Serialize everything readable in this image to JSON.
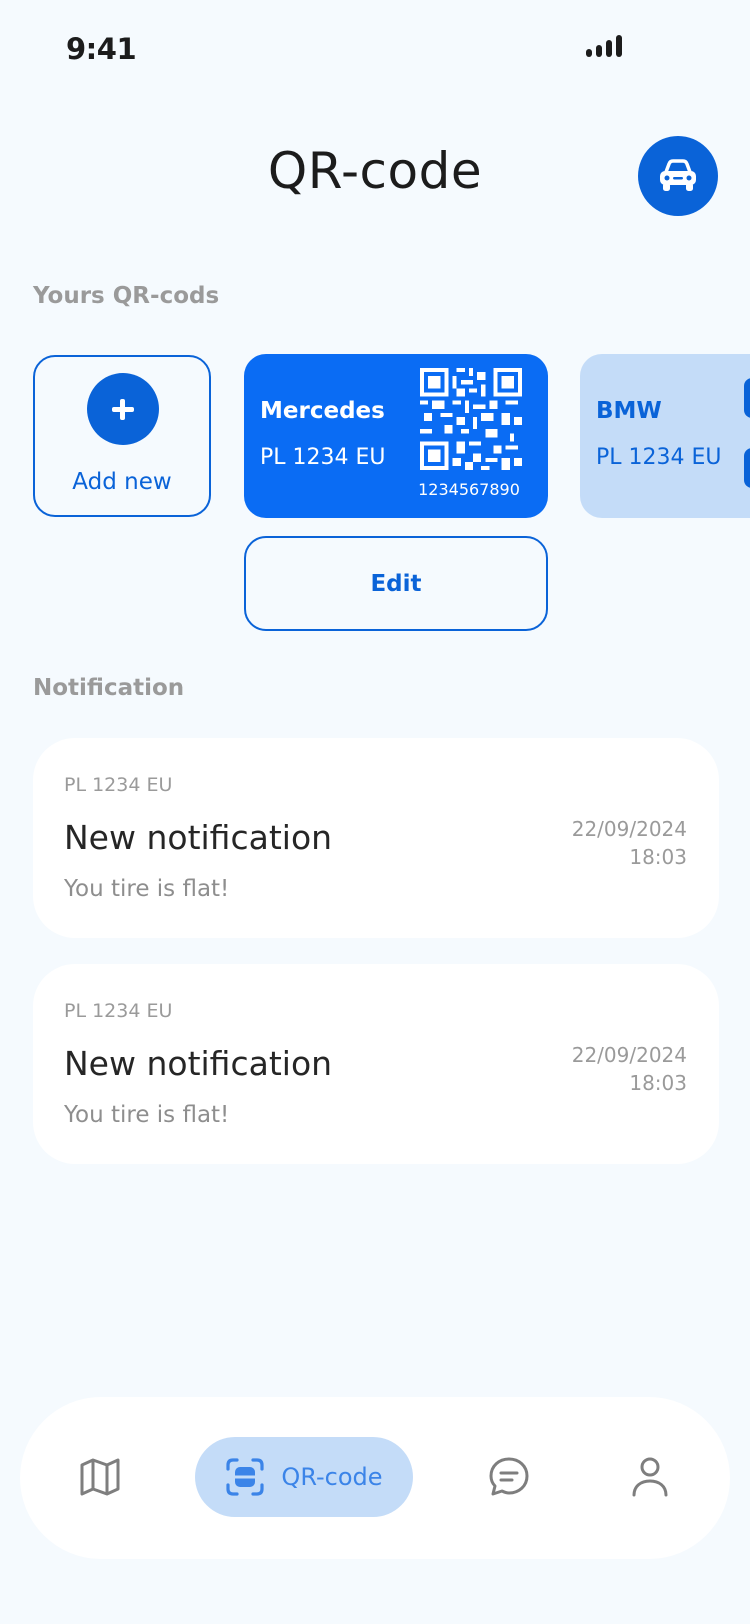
{
  "status_bar": {
    "time": "9:41"
  },
  "header": {
    "title": "QR-code",
    "action_icon": "car-icon"
  },
  "qr_section": {
    "title": "Yours QR-cods",
    "add_new_label": "Add new",
    "cards": [
      {
        "name": "Mercedes",
        "plate": "PL 1234 EU",
        "code": "1234567890",
        "color": "#0a6cf4",
        "selected": true
      },
      {
        "name": "BMW",
        "plate": "PL 1234 EU",
        "color": "#c4dcf8",
        "selected": false
      }
    ],
    "edit_label": "Edit"
  },
  "notification_section": {
    "title": "Notification",
    "items": [
      {
        "plate": "PL 1234 EU",
        "title": "New notification",
        "body": "You tire is flat!",
        "date": "22/09/2024",
        "time": "18:03"
      },
      {
        "plate": "PL 1234 EU",
        "title": "New notification",
        "body": "You tire is flat!",
        "date": "22/09/2024",
        "time": "18:03"
      }
    ]
  },
  "bottom_nav": {
    "items": [
      {
        "icon": "map-icon",
        "label": ""
      },
      {
        "icon": "qr-scan-icon",
        "label": "QR-code",
        "active": true
      },
      {
        "icon": "chat-icon",
        "label": ""
      },
      {
        "icon": "profile-icon",
        "label": ""
      }
    ]
  },
  "colors": {
    "accent": "#0a63d8",
    "card_blue": "#0a6cf4",
    "card_light": "#c4dcf8",
    "background": "#f5fafe"
  }
}
